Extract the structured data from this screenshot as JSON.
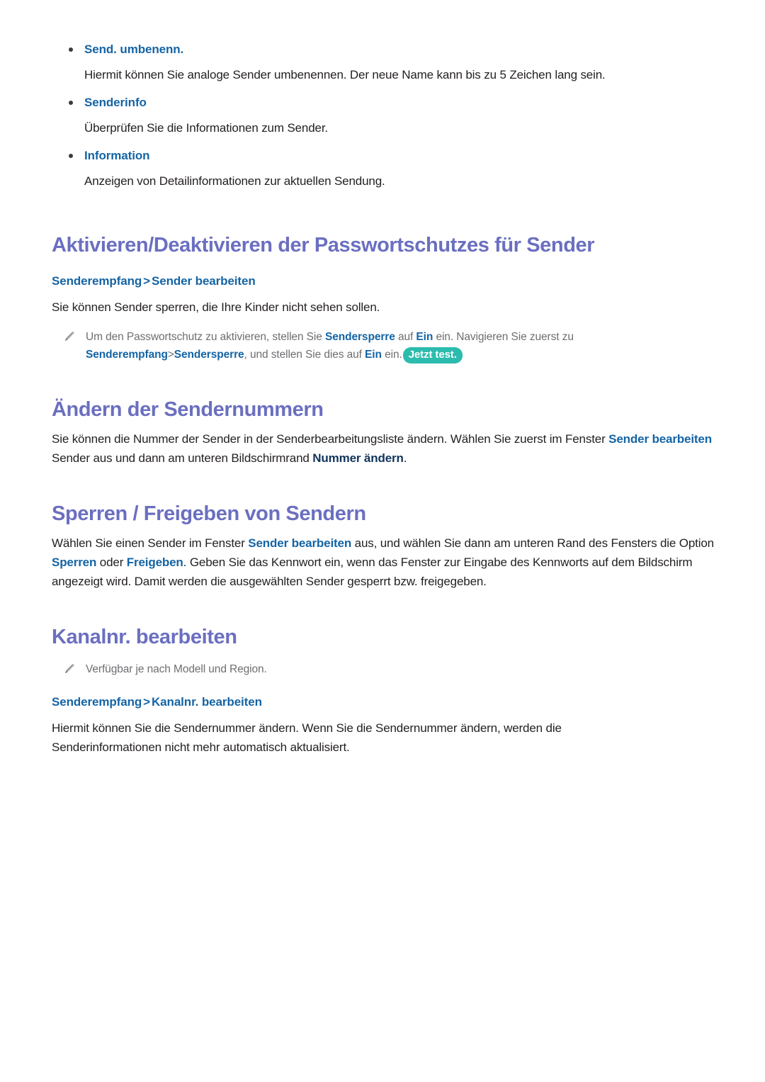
{
  "colors": {
    "heading": "#6B6FC0",
    "link_blue": "#1464A5",
    "navy_blue": "#12355B",
    "body_text": "#231F20",
    "note_text": "#6D6E71",
    "badge_bg": "#2BBCAD",
    "badge_text": "#FFFFFF",
    "background": "#FFFFFF"
  },
  "bullets": [
    {
      "label": "Send. umbenenn.",
      "description": "Hiermit können Sie analoge Sender umbenennen. Der neue Name kann bis zu 5 Zeichen lang sein."
    },
    {
      "label": "Senderinfo",
      "description": "Überprüfen Sie die Informationen zum Sender."
    },
    {
      "label": "Information",
      "description": "Anzeigen von Detailinformationen zur aktuellen Sendung."
    }
  ],
  "sections": [
    {
      "title": "Aktivieren/Deaktivieren der Passwortschutzes für Sender",
      "breadcrumb": {
        "first": "Senderempfang",
        "separator": ">",
        "second": "Sender bearbeiten"
      },
      "paragraph": "Sie können Sender sperren, die Ihre Kinder nicht sehen sollen.",
      "note": {
        "icon": "pencil-icon",
        "line1_part1": "Um den Passwortschutz zu aktivieren, stellen Sie ",
        "line1_bold1": "Sendersperre",
        "line1_part2": " auf ",
        "line1_bold2": "Ein",
        "line1_part3": " ein. Navigieren Sie zuerst zu ",
        "line2_bold1": "Senderempfang",
        "line2_sep": ">",
        "line2_bold2": "Sendersperre",
        "line2_part1": ", und stellen Sie dies auf ",
        "line2_bold3": "Ein",
        "line2_part2": " ein.",
        "badge": "Jetzt test."
      }
    },
    {
      "title": "Ändern der Sendernummern",
      "paragraph_part1": "Sie können die Nummer der Sender in der Senderbearbeitungsliste ändern. Wählen Sie zuerst im Fenster ",
      "paragraph_bold1": "Sender bearbeiten",
      "paragraph_part2": " Sender aus und dann am unteren Bildschirmrand ",
      "paragraph_bold2": "Nummer ändern",
      "paragraph_part3": "."
    },
    {
      "title": "Sperren / Freigeben von Sendern",
      "paragraph_part1": "Wählen Sie einen Sender im Fenster ",
      "paragraph_bold1": "Sender bearbeiten",
      "paragraph_part2": " aus, und wählen Sie dann am unteren Rand des Fensters die Option ",
      "paragraph_bold2": "Sperren",
      "paragraph_part3": " oder ",
      "paragraph_bold3": "Freigeben",
      "paragraph_part4": ". Geben Sie das Kennwort ein, wenn das Fenster zur Eingabe des Kennworts auf dem Bildschirm angezeigt wird. Damit werden die ausgewählten Sender gesperrt bzw. freigegeben."
    },
    {
      "title": "Kanalnr. bearbeiten",
      "note": {
        "icon": "pencil-icon",
        "text": "Verfügbar je nach Modell und Region."
      },
      "breadcrumb": {
        "first": "Senderempfang",
        "separator": ">",
        "second": "Kanalnr. bearbeiten"
      },
      "paragraph": "Hiermit können Sie die Sendernummer ändern. Wenn Sie die Sendernummer ändern, werden die Senderinformationen nicht mehr automatisch aktualisiert."
    }
  ]
}
